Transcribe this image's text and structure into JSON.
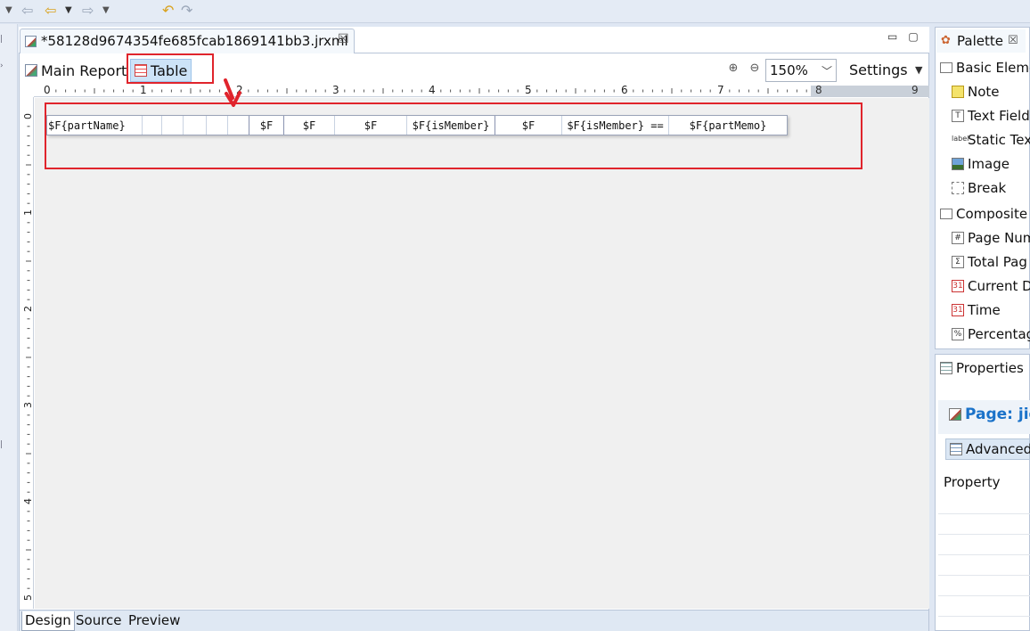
{
  "toolbar": {
    "icons": [
      "menu-chevron-icon",
      "back-icon",
      "back-colored-icon",
      "dropdown-chevron-icon",
      "forward-icon",
      "dropdown-chevron-icon",
      "undo-icon",
      "redo-icon"
    ]
  },
  "editor": {
    "tab_title": "*58128d9674354fe685fcab1869141bb3.jrxml",
    "tab_close": "☒",
    "minimize": "▭",
    "maximize": "▢"
  },
  "subtabs": {
    "main_report": "Main Report",
    "table": "Table"
  },
  "zoom": {
    "value": "150%",
    "settings_label": "Settings"
  },
  "ruler": {
    "h_numbers": [
      "0",
      "1",
      "2",
      "3",
      "4",
      "5",
      "6",
      "7",
      "8",
      "9"
    ],
    "v_numbers": [
      "0",
      "1",
      "2",
      "3",
      "4",
      "5"
    ]
  },
  "table": {
    "cells": [
      "$F{partName}",
      "$F",
      "$F",
      "$F",
      "$F{isMember}",
      "$F",
      "$F{isMember} ==",
      "$F{partMemo}"
    ]
  },
  "bottom_tabs": {
    "design": "Design",
    "source": "Source",
    "preview": "Preview"
  },
  "palette": {
    "title": "Palette",
    "close": "☒",
    "basic_category": "Basic Eleme",
    "basic_items": [
      "Note",
      "Text Field",
      "Static Tex",
      "Image",
      "Break"
    ],
    "composite_category": "Composite",
    "composite_items": [
      "Page Num",
      "Total Pag",
      "Current D",
      "Time",
      "Percentag"
    ]
  },
  "properties": {
    "title": "Properties",
    "page_label": "Page: jie",
    "advanced_label": "Advanced",
    "property_header": "Property"
  },
  "colors": {
    "accent_red": "#e0242c",
    "selection_blue": "#cde3f7",
    "page_label_blue": "#1a72c9"
  }
}
